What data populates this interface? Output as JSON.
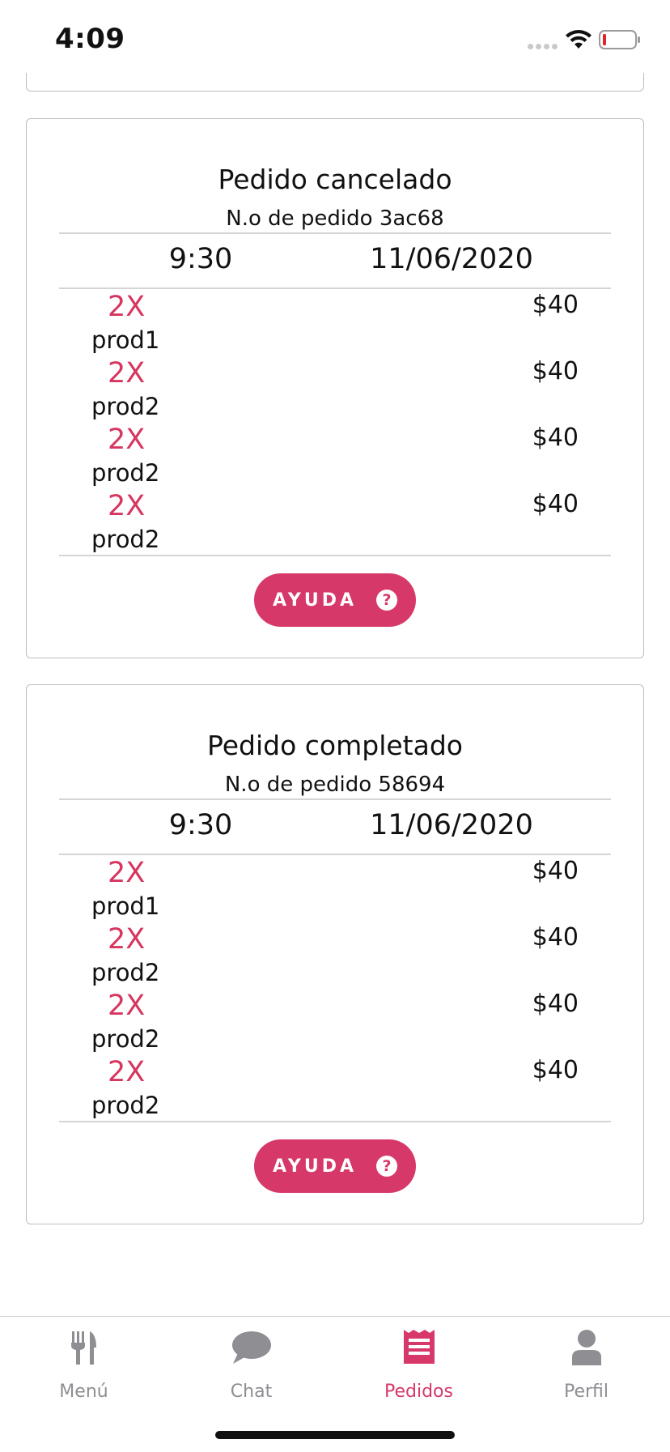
{
  "status_bar": {
    "time": "4:09"
  },
  "orders": [
    {
      "status_title": "Pedido cancelado",
      "order_number": "N.o de pedido 3ac68",
      "time": "9:30",
      "date": "11/06/2020",
      "items": [
        {
          "qty": "2X",
          "name": "prod1",
          "price": "$40"
        },
        {
          "qty": "2X",
          "name": "prod2",
          "price": "$40"
        },
        {
          "qty": "2X",
          "name": "prod2",
          "price": "$40"
        },
        {
          "qty": "2X",
          "name": "prod2",
          "price": "$40"
        }
      ],
      "help_label": "AYUDA"
    },
    {
      "status_title": "Pedido completado",
      "order_number": "N.o de pedido 58694",
      "time": "9:30",
      "date": "11/06/2020",
      "items": [
        {
          "qty": "2X",
          "name": "prod1",
          "price": "$40"
        },
        {
          "qty": "2X",
          "name": "prod2",
          "price": "$40"
        },
        {
          "qty": "2X",
          "name": "prod2",
          "price": "$40"
        },
        {
          "qty": "2X",
          "name": "prod2",
          "price": "$40"
        }
      ],
      "help_label": "AYUDA"
    }
  ],
  "help_icon_glyph": "?",
  "tab_bar": {
    "tabs": [
      {
        "label": "Menú",
        "icon": "utensils-icon"
      },
      {
        "label": "Chat",
        "icon": "chat-bubble-icon"
      },
      {
        "label": "Pedidos",
        "icon": "receipt-icon"
      },
      {
        "label": "Perfil",
        "icon": "user-icon"
      }
    ],
    "active_tab": "Pedidos"
  },
  "colors": {
    "accent": "#d7386a",
    "quantity": "#d6365f",
    "inactive_tab": "#8e8e93",
    "card_border": "#bdbdbd"
  }
}
